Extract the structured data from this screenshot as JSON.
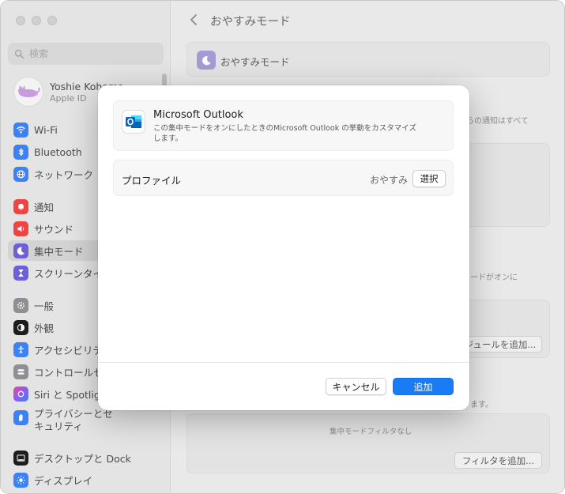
{
  "window": {
    "traffic_lights": [
      "close-button",
      "minimize-button",
      "zoom-button"
    ]
  },
  "sidebar": {
    "search_placeholder": "検索",
    "account": {
      "name": "Yoshie Kohama",
      "subtitle": "Apple ID"
    },
    "items": [
      {
        "label": "Wi-Fi",
        "icon": "wifi-icon",
        "color": "#3b82f6"
      },
      {
        "label": "Bluetooth",
        "icon": "bluetooth-icon",
        "color": "#3b82f6"
      },
      {
        "label": "ネットワーク",
        "icon": "globe-icon",
        "color": "#3b82f6"
      },
      {
        "label": "通知",
        "icon": "bell-icon",
        "color": "#ef4444"
      },
      {
        "label": "サウンド",
        "icon": "speaker-icon",
        "color": "#ef4444"
      },
      {
        "label": "集中モード",
        "icon": "moon-icon",
        "color": "#6d5fd6",
        "active": true
      },
      {
        "label": "スクリーンタイム",
        "icon": "hourglass-icon",
        "color": "#6d5fd6"
      },
      {
        "label": "一般",
        "icon": "gear-icon",
        "color": "#8e8e93"
      },
      {
        "label": "外観",
        "icon": "appearance-icon",
        "color": "#1d1d1f"
      },
      {
        "label": "アクセシビリティ",
        "icon": "accessibility-icon",
        "color": "#3b82f6"
      },
      {
        "label": "コントロールセンター",
        "icon": "control-center-icon",
        "color": "#8e8e93"
      },
      {
        "label": "Siri と Spotlight",
        "icon": "siri-icon",
        "color": "#a855f7"
      },
      {
        "label": "プライバシーとセキュリティ",
        "icon": "hand-icon",
        "color": "#3b82f6"
      },
      {
        "label": "デスクトップと Dock",
        "icon": "dock-icon",
        "color": "#1d1d1f"
      },
      {
        "label": "ディスプレイ",
        "icon": "sun-icon",
        "color": "#3b82f6"
      }
    ]
  },
  "main": {
    "title": "おやすみモード",
    "focus_row_label": "おやすみモード",
    "bg_text_1": "からの通知はすべて",
    "bg_text_2": "ードがオンに",
    "bg_button_schedule": "ジュールを追加...",
    "bg_text_3": "ます。",
    "bg_empty_filters": "集中モードフィルタなし",
    "bg_button_filter": "フィルタを追加..."
  },
  "dialog": {
    "app_name": "Microsoft Outlook",
    "app_icon": "outlook-icon",
    "app_description": "この集中モードをオンにしたときのMicrosoft Outlook の挙動をカスタマイズします。",
    "profile_label": "プロファイル",
    "profile_value": "おやすみ",
    "select_button": "選択",
    "cancel_button": "キャンセル",
    "add_button": "追加"
  },
  "colors": {
    "accent": "#1a7cf4",
    "focus_purple": "#6d5fd6"
  }
}
